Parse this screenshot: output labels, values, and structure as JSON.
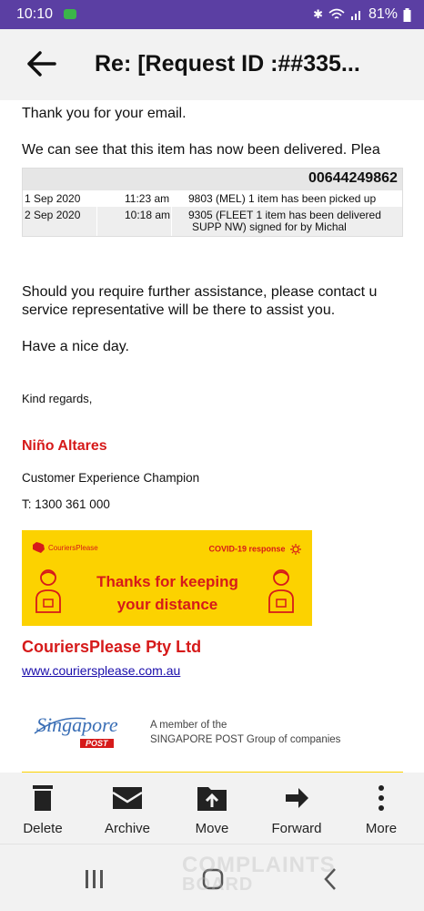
{
  "status_bar": {
    "time": "10:10",
    "battery": "81%"
  },
  "header": {
    "title": "Re: [Request ID :##335..."
  },
  "email": {
    "greeting": "Thank you for your email.",
    "delivered_text": "We can see that this item has now been delivered. Plea",
    "tracking": {
      "number": "00644249862",
      "rows": [
        {
          "date": "1 Sep 2020",
          "time": "11:23 am",
          "detail_line1": "9803 (MEL) 1 item has been picked up",
          "detail_line2": ""
        },
        {
          "date": "2 Sep 2020",
          "time": "10:18 am",
          "detail_line1": "9305 (FLEET 1 item has been delivered",
          "detail_line2": "SUPP NW) signed for by Michal"
        }
      ]
    },
    "assist_line1": "Should you require further assistance, please contact u",
    "assist_line2": "service representative will be there to assist you.",
    "nice_day": "Have a nice day.",
    "regards": "Kind regards,",
    "sender_name": "Niño Altares",
    "sender_role": "Customer Experience Champion",
    "sender_phone": "T: 1300 361 000",
    "banner": {
      "logo_text": "CouriersPlease",
      "covid_label": "COVID-19 response",
      "message_line1": "Thanks for keeping",
      "message_line2": "your distance"
    },
    "company_name": "CouriersPlease Pty Ltd",
    "company_url": "www.couriersplease.com.au",
    "singpost": {
      "logo_script": "Singapore",
      "logo_post": "POST",
      "member_line1": "A member of the",
      "member_line2": "SINGAPORE POST Group of companies"
    }
  },
  "toolbar": {
    "delete": "Delete",
    "archive": "Archive",
    "move": "Move",
    "forward": "Forward",
    "more": "More"
  },
  "watermark": {
    "line1": "COMPLAINTS",
    "line2": "BOARD"
  },
  "colors": {
    "status_bar": "#5b3fa3",
    "accent_red": "#d61a1a",
    "banner_yellow": "#fcd200",
    "link_blue": "#1a0dab"
  }
}
